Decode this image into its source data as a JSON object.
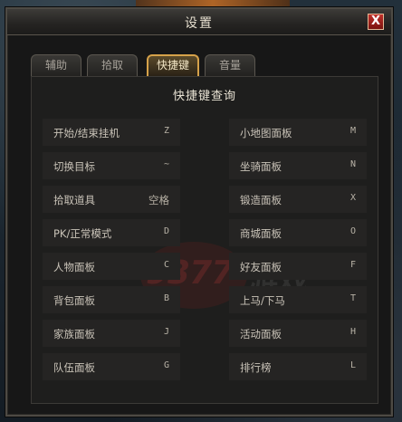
{
  "window": {
    "title": "设置",
    "close_label": "X"
  },
  "tabs": [
    {
      "label": "辅助",
      "active": false
    },
    {
      "label": "拾取",
      "active": false
    },
    {
      "label": "快捷键",
      "active": true
    },
    {
      "label": "音量",
      "active": false
    }
  ],
  "panel": {
    "title": "快捷键查询"
  },
  "shortcuts_left": [
    {
      "label": "开始/结束挂机",
      "key": "Z"
    },
    {
      "label": "切换目标",
      "key": "~"
    },
    {
      "label": "拾取道具",
      "key": "空格"
    },
    {
      "label": "PK/正常模式",
      "key": "D"
    },
    {
      "label": "人物面板",
      "key": "C"
    },
    {
      "label": "背包面板",
      "key": "B"
    },
    {
      "label": "家族面板",
      "key": "J"
    },
    {
      "label": "队伍面板",
      "key": "G"
    }
  ],
  "shortcuts_right": [
    {
      "label": "小地图面板",
      "key": "M"
    },
    {
      "label": "坐骑面板",
      "key": "N"
    },
    {
      "label": "锻造面板",
      "key": "X"
    },
    {
      "label": "商城面板",
      "key": "O"
    },
    {
      "label": "好友面板",
      "key": "F"
    },
    {
      "label": "上马/下马",
      "key": "T"
    },
    {
      "label": "活动面板",
      "key": "H"
    },
    {
      "label": "排行榜",
      "key": "L"
    }
  ],
  "watermark": {
    "brand_number": "9377",
    "brand_text": "游戏",
    "brand_sub": "GAMES"
  },
  "colors": {
    "active_tab_border": "#d6a24a",
    "close_button": "#c0302a",
    "row_background": "#252423"
  }
}
